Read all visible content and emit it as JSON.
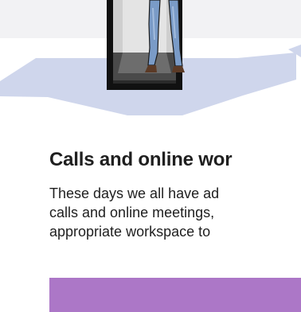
{
  "section": {
    "title": "Calls and online wor",
    "body_lines": [
      "These days we all have ad",
      "calls and online meetings,",
      "appropriate workspace to"
    ]
  },
  "colors": {
    "top_band": "#f2f2f4",
    "blob": "#cfd6ec",
    "booth_frame": "#111111",
    "cta_bar": "#ac77c7",
    "jeans": "#7a9bc7"
  },
  "illustration": {
    "subject": "person-in-phone-booth"
  }
}
